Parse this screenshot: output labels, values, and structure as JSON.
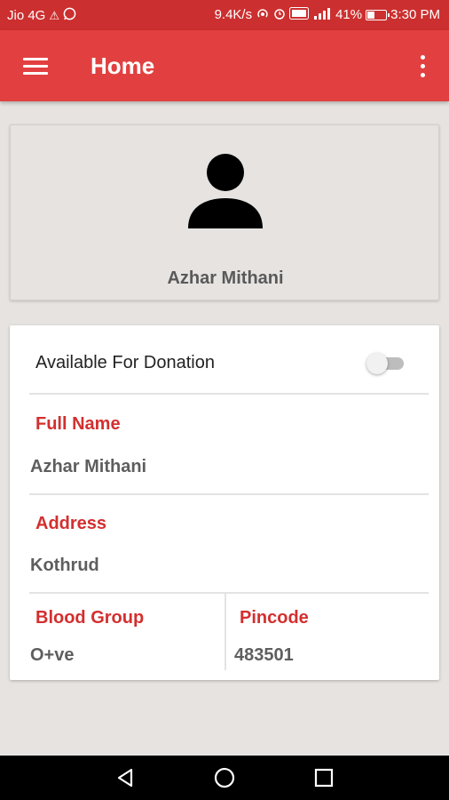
{
  "status_bar": {
    "carrier": "Jio 4G",
    "speed": "9.4K/s",
    "battery_text": "41%",
    "battery_level": 0.41,
    "time": "3:30 PM"
  },
  "app_bar": {
    "title": "Home",
    "menu_icon": "hamburger-menu-icon",
    "overflow_icon": "more-vert-icon"
  },
  "profile": {
    "avatar_icon": "person-icon",
    "name": "Azhar Mithani"
  },
  "details": {
    "availability_label": "Available For Donation",
    "availability_on": false,
    "full_name_label": "Full Name",
    "full_name": "Azhar Mithani",
    "address_label": "Address",
    "address": "Kothrud",
    "blood_group_label": "Blood Group",
    "blood_group": "O+ve",
    "pincode_label": "Pincode",
    "pincode": "483501"
  },
  "colors": {
    "status_bar": "#cc2f2f",
    "app_bar": "#e24040",
    "accent": "#d32f2f",
    "background": "#e6e3e1"
  }
}
